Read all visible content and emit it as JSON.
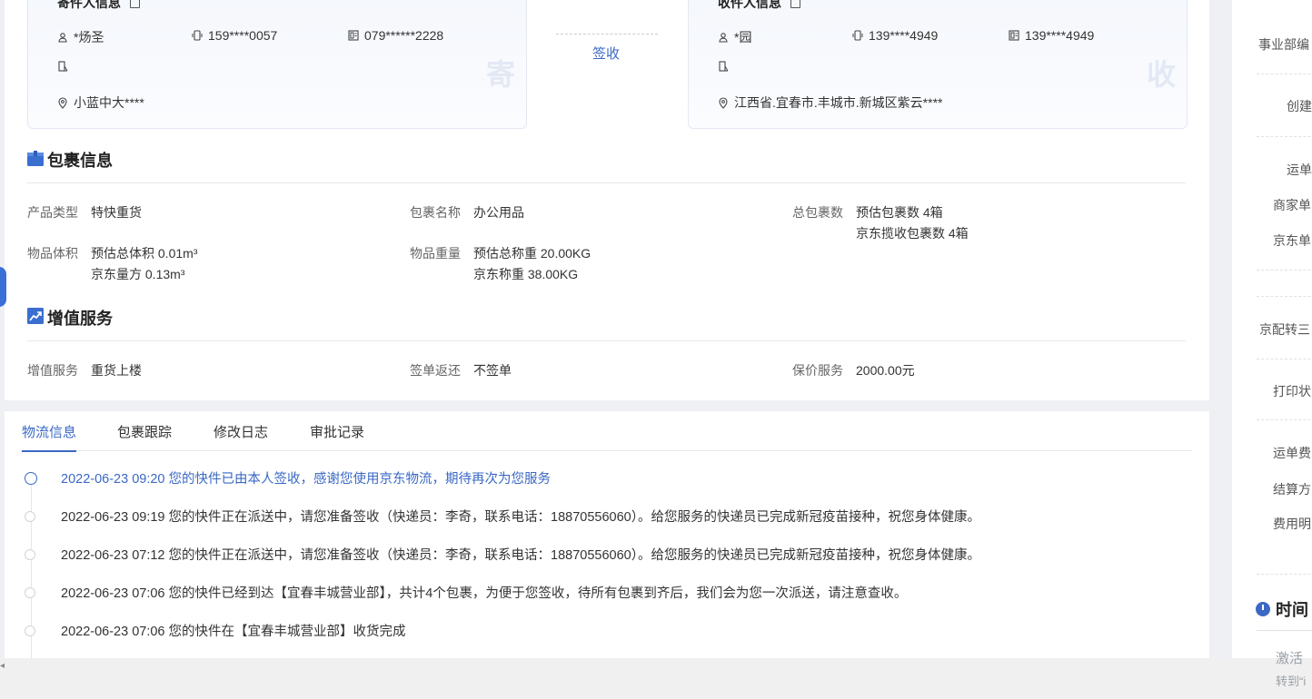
{
  "sender": {
    "title": "寄件人信息",
    "name": "*炀圣",
    "mobile": "159****0057",
    "phone": "079******2228",
    "address": "小蓝中大****",
    "watermark": "寄"
  },
  "receiver": {
    "title": "收件人信息",
    "name": "*园",
    "mobile": "139****4949",
    "phone": "139****4949",
    "address": "江西省.宜春市.丰城市.新城区紫云****",
    "watermark": "收"
  },
  "sign_status": "签收",
  "package": {
    "title": "包裹信息",
    "product_type_label": "产品类型",
    "product_type": "特快重货",
    "package_name_label": "包裹名称",
    "package_name": "办公用品",
    "total_label": "总包裹数",
    "total_line1": "预估包裹数 4箱",
    "total_line2": "京东揽收包裹数 4箱",
    "volume_label": "物品体积",
    "volume_line1": "预估总体积 0.01m³",
    "volume_line2": "京东量方 0.13m³",
    "weight_label": "物品重量",
    "weight_line1": "预估总称重 20.00KG",
    "weight_line2": "京东称重 38.00KG"
  },
  "value_added": {
    "title": "增值服务",
    "service_label": "增值服务",
    "service": "重货上楼",
    "receipt_label": "签单返还",
    "receipt": "不签单",
    "insurance_label": "保价服务",
    "insurance": "2000.00元"
  },
  "tabs": [
    "物流信息",
    "包裹跟踪",
    "修改日志",
    "审批记录"
  ],
  "timeline": [
    "2022-06-23 09:20 您的快件已由本人签收，感谢您使用京东物流，期待再次为您服务",
    "2022-06-23 09:19 您的快件正在派送中，请您准备签收（快递员：李奇，联系电话：18870556060）。给您服务的快递员已完成新冠疫苗接种，祝您身体健康。",
    "2022-06-23 07:12 您的快件正在派送中，请您准备签收（快递员：李奇，联系电话：18870556060）。给您服务的快递员已完成新冠疫苗接种，祝您身体健康。",
    "2022-06-23 07:06 您的快件已经到达【宜春丰城营业部】，共计4个包裹，为便于您签收，待所有包裹到齐后，我们会为您一次派送，请注意查收。",
    "2022-06-23 07:06 您的快件在【宜春丰城营业部】收货完成"
  ],
  "sidebar": {
    "items": [
      "事业部编",
      "创建",
      "运单",
      "商家单",
      "京东单",
      "京配转三",
      "打印状",
      "运单费",
      "结算方",
      "费用明"
    ],
    "section_title": "时间"
  },
  "activate": {
    "line1": "激活",
    "line2": "转到“i"
  }
}
